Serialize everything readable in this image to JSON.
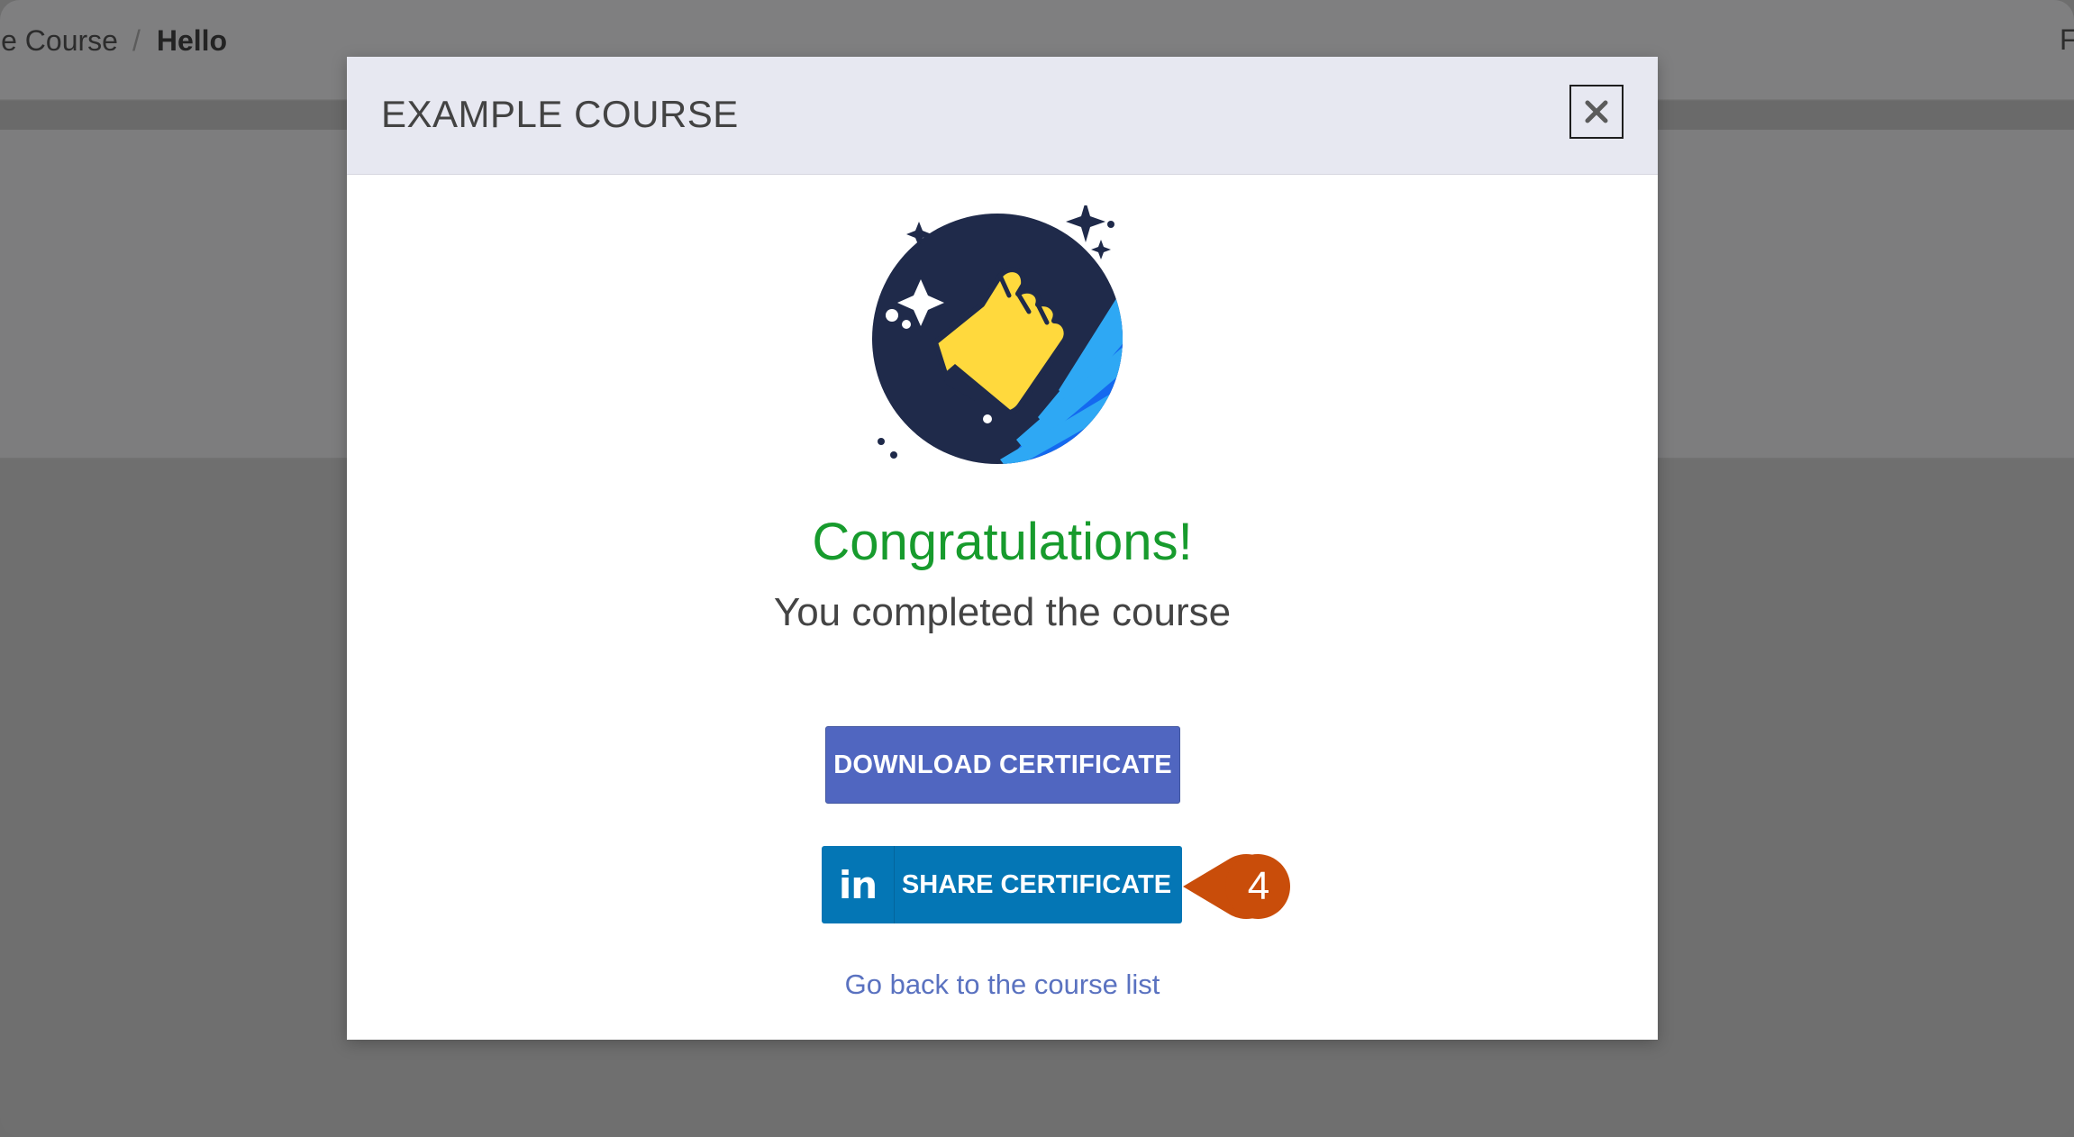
{
  "breadcrumb": {
    "previous": "le Course",
    "separator": "/",
    "current": "Hello"
  },
  "topbar": {
    "right_text": "F"
  },
  "modal": {
    "title": "EXAMPLE COURSE",
    "close_label": "×",
    "illustration_icon": "thumbs-up-rocket-icon",
    "heading": "Congratulations!",
    "subheading": "You completed the course",
    "download_button": "DOWNLOAD CERTIFICATE",
    "share_button": {
      "icon": "linkedin-icon",
      "icon_text": "in",
      "label": "SHARE CERTIFICATE"
    },
    "back_link": "Go back to the course list"
  },
  "callout": {
    "step": "4"
  },
  "colors": {
    "overlay": "#6e6e6e",
    "header_bg": "#e7e8f1",
    "congrats_green": "#179b2d",
    "download_blue": "#5066c0",
    "linkedin_blue": "#0476b5",
    "link_blue": "#5a72c0",
    "callout_orange": "#c94d0a"
  }
}
